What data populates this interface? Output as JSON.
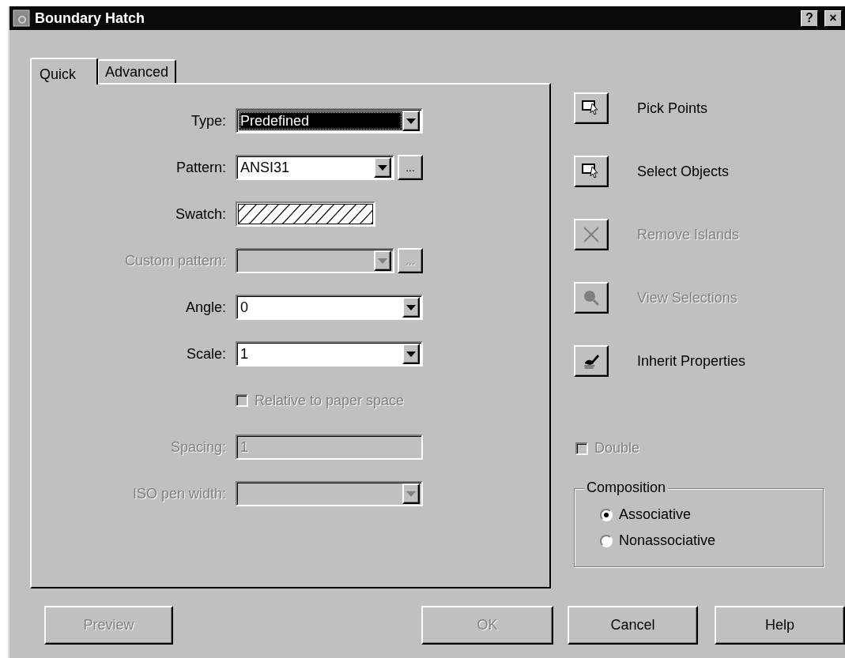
{
  "window": {
    "title": "Boundary Hatch",
    "title_buttons": [
      "?",
      "×"
    ]
  },
  "tabs": [
    {
      "label": "Quick",
      "selected": true
    },
    {
      "label": "Advanced",
      "selected": false
    }
  ],
  "fields": [
    {
      "kind": "combo",
      "label": "Type:",
      "value": "Predefined",
      "focused": true,
      "disabled": false,
      "browse": false
    },
    {
      "kind": "combo",
      "label": "Pattern:",
      "value": "ANSI31",
      "focused": false,
      "disabled": false,
      "browse": true,
      "browse_label": "..."
    },
    {
      "kind": "swatch",
      "label": "Swatch:"
    },
    {
      "kind": "combo",
      "label": "Custom pattern:",
      "focused": false,
      "disabled": true,
      "browse": true,
      "browse_label": "..."
    },
    {
      "kind": "combo",
      "label": "Angle:",
      "value": "0",
      "focused": false,
      "disabled": false,
      "browse": false
    },
    {
      "kind": "combo",
      "label": "Scale:",
      "value": "1",
      "focused": false,
      "disabled": false,
      "browse": false
    },
    {
      "kind": "checkbox",
      "label": "Relative to paper space",
      "checked": false,
      "disabled": true
    },
    {
      "kind": "text",
      "label": "Spacing:",
      "value": "1",
      "disabled": true
    },
    {
      "kind": "combo",
      "label": "ISO pen width:",
      "focused": false,
      "disabled": true,
      "browse": false
    }
  ],
  "actions": [
    {
      "kind": "pick",
      "label": "Pick Points",
      "disabled": false
    },
    {
      "kind": "select",
      "label": "Select Objects",
      "disabled": false
    },
    {
      "kind": "remove",
      "label": "Remove Islands",
      "disabled": true
    },
    {
      "kind": "view",
      "label": "View Selections",
      "disabled": true
    },
    {
      "kind": "inherit",
      "label": "Inherit Properties",
      "disabled": false
    }
  ],
  "double": {
    "label": "Double",
    "checked": false,
    "disabled": true
  },
  "composition": {
    "title": "Composition",
    "options": [
      {
        "label": "Associative",
        "selected": true
      },
      {
        "label": "Nonassociative",
        "selected": false
      }
    ]
  },
  "buttons": [
    {
      "label": "Preview",
      "disabled": true
    },
    {
      "label": "OK",
      "disabled": true
    },
    {
      "label": "Cancel",
      "disabled": false
    },
    {
      "label": "Help",
      "disabled": false
    }
  ]
}
